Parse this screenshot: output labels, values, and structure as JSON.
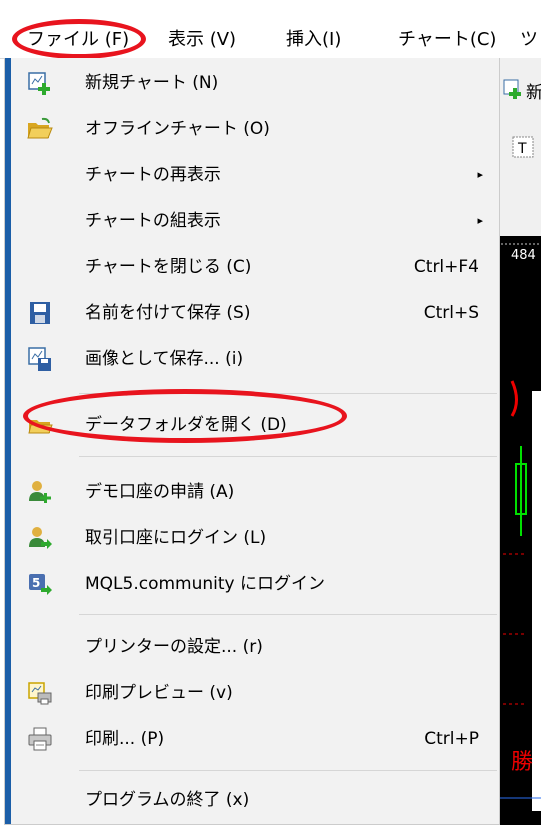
{
  "menubar": {
    "items": [
      {
        "label": "ファイル (F)"
      },
      {
        "label": "表示 (V)"
      },
      {
        "label": "挿入(I)"
      },
      {
        "label": "チャート(C)"
      },
      {
        "label": "ツ"
      }
    ]
  },
  "background": {
    "price_label": "484",
    "toolbar_char": "新",
    "text_char": "勝"
  },
  "file_menu": {
    "items": [
      {
        "label": "新規チャート (N)",
        "icon": "new-chart-icon"
      },
      {
        "label": "オフラインチャート (O)",
        "icon": "open-folder-icon"
      },
      {
        "label": "チャートの再表示",
        "submenu": "▸"
      },
      {
        "label": "チャートの組表示",
        "submenu": "▸"
      },
      {
        "label": "チャートを閉じる (C)",
        "shortcut": "Ctrl+F4"
      },
      {
        "label": "名前を付けて保存 (S)",
        "shortcut": "Ctrl+S",
        "icon": "floppy-disk-icon"
      },
      {
        "label": "画像として保存... (i)",
        "icon": "save-image-icon"
      },
      {
        "label": "データフォルダを開く (D)",
        "icon": "data-folder-icon"
      },
      {
        "label": "デモ口座の申請 (A)",
        "icon": "user-add-icon"
      },
      {
        "label": "取引口座にログイン (L)",
        "icon": "user-login-icon"
      },
      {
        "label": "MQL5.community にログイン",
        "icon": "mql5-icon"
      },
      {
        "label": "プリンターの設定... (r)"
      },
      {
        "label": "印刷プレビュー (v)",
        "icon": "print-preview-icon"
      },
      {
        "label": "印刷... (P)",
        "shortcut": "Ctrl+P",
        "icon": "printer-icon"
      },
      {
        "label": "プログラムの終了 (x)"
      }
    ]
  },
  "colors": {
    "highlight_circle": "#e8141e",
    "menu_background": "#f2f2f2",
    "left_strip": "#1b5ea8"
  }
}
